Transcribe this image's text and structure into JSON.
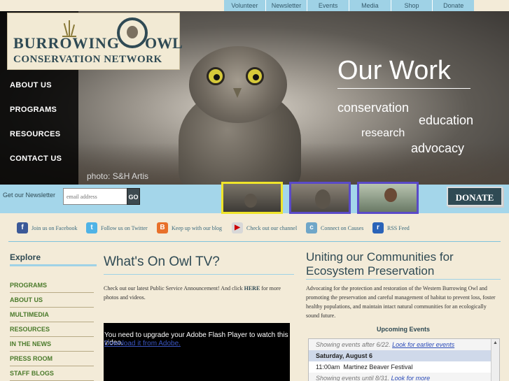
{
  "top_nav": [
    "Volunteer",
    "Newsletter",
    "Events",
    "Media",
    "Shop",
    "Donate"
  ],
  "logo": {
    "line1": "BURROWING",
    "line2": "OWL",
    "line3": "CONSERVATION NETWORK"
  },
  "side_nav": [
    "ABOUT US",
    "PROGRAMS",
    "RESOURCES",
    "CONTACT US"
  ],
  "hero": {
    "heading": "Our Work",
    "tags": [
      "conservation",
      "education",
      "research",
      "advocacy"
    ],
    "photo_credit": "photo: S&H Artis"
  },
  "newsletter": {
    "label": "Get our Newsletter",
    "placeholder": "email address",
    "go": "GO"
  },
  "donate_label": "DONATE",
  "social": [
    {
      "label": "Join us on Facebook",
      "icon": "facebook-icon",
      "color": "#3b5998",
      "glyph": "f"
    },
    {
      "label": "Follow us on Twitter",
      "icon": "twitter-icon",
      "color": "#4fb3e6",
      "glyph": "t"
    },
    {
      "label": "Keep up with our blog",
      "icon": "blogger-icon",
      "color": "#e8702a",
      "glyph": "B"
    },
    {
      "label": "Check out our channel",
      "icon": "youtube-icon",
      "color": "#d8d8d8",
      "glyph": "▶"
    },
    {
      "label": "Connect on Causes",
      "icon": "causes-icon",
      "color": "#6fa6c8",
      "glyph": "c"
    },
    {
      "label": "RSS Feed",
      "icon": "rss-icon",
      "color": "#2a63b8",
      "glyph": "r"
    }
  ],
  "explore": {
    "title": "Explore",
    "items": [
      "PROGRAMS",
      "ABOUT US",
      "MULTIMEDIA",
      "RESOURCES",
      "IN THE NEWS",
      "PRESS ROOM",
      "STAFF BLOGS"
    ]
  },
  "owl_tv": {
    "title": "What's On Owl TV?",
    "text_before": "Check out our latest Public Service Announcement! And click ",
    "link": "HERE",
    "text_after": " for more photos and videos.",
    "flash_message": "You need to upgrade your Adobe Flash Player to watch this video.",
    "flash_link": "Download it from Adobe."
  },
  "uniting": {
    "title": "Uniting our Communities for Ecosystem Preservation",
    "text": "Advocating for the protection and restoration of the Western Burrowing Owl and promoting the preservation and careful management of habitat to prevent loss, foster healthy populations, and maintain intact natural communities for an ecologically sound future."
  },
  "events": {
    "title": "Upcoming Events",
    "before_note": "Showing events after 6/22.",
    "before_link": "Look for earlier events",
    "day": "Saturday, August 6",
    "event_time": "11:00am",
    "event_name": "Martinez Beaver Festival",
    "after_note": "Showing events until 8/31.",
    "after_link": "Look for more"
  }
}
